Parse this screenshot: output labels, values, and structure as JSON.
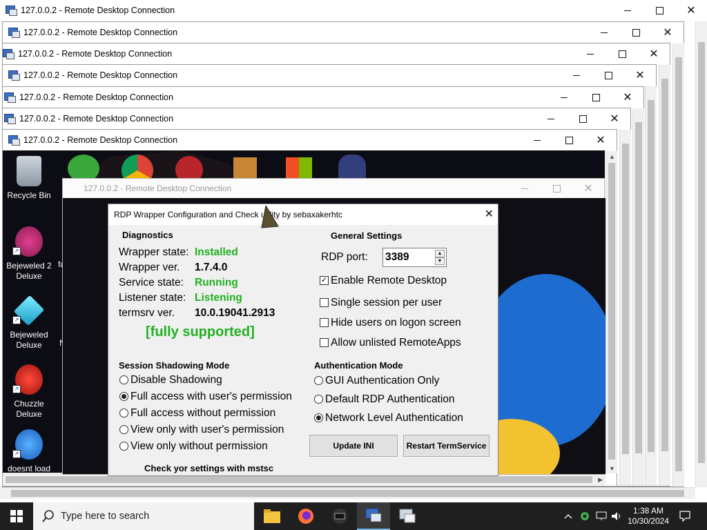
{
  "windows": [
    {
      "title": "127.0.0.2 - Remote Desktop Connection"
    },
    {
      "title": "127.0.0.2 - Remote Desktop Connection"
    },
    {
      "title": "127.0.0.2 - Remote Desktop Connection"
    },
    {
      "title": "127.0.0.2 - Remote Desktop Connection"
    },
    {
      "title": "127.0.0.2 - Remote Desktop Connection"
    },
    {
      "title": "127.0.0.2 - Remote Desktop Connection"
    },
    {
      "title": "127.0.0.2 - Remote Desktop Connection"
    },
    {
      "title": "127.0.0.2 - Remote Desktop Connection"
    }
  ],
  "desktop": {
    "icons": [
      {
        "label": "Recycle Bin"
      },
      {
        "label": "Bejeweled 2 Deluxe"
      },
      {
        "label": "Bejeweled Deluxe"
      },
      {
        "label": "Chuzzle Deluxe"
      },
      {
        "label": "doesnt load"
      }
    ],
    "peek": {
      "fa": "fa",
      "n": "N"
    }
  },
  "dialog": {
    "title": "RDP Wrapper Configuration and Check utility by sebaxakerhtc",
    "diagnostics": {
      "header": "Diagnostics",
      "wrapper_state_label": "Wrapper state:",
      "wrapper_state_value": "Installed",
      "wrapper_ver_label": "Wrapper ver.",
      "wrapper_ver_value": "1.7.4.0",
      "service_state_label": "Service state:",
      "service_state_value": "Running",
      "listener_state_label": "Listener state:",
      "listener_state_value": "Listening",
      "termsrv_label": "termsrv ver.",
      "termsrv_value": "10.0.19041.2913",
      "support_status": "[fully supported]"
    },
    "general": {
      "header": "General Settings",
      "rdp_port_label": "RDP port:",
      "rdp_port_value": "3389",
      "enable_remote_desktop": "Enable Remote Desktop",
      "single_session": "Single session per user",
      "hide_users": "Hide users on logon screen",
      "allow_unlisted": "Allow unlisted RemoteApps"
    },
    "shadowing": {
      "header": "Session Shadowing Mode",
      "options": [
        {
          "label": "Disable Shadowing"
        },
        {
          "label": "Full access with user's permission"
        },
        {
          "label": "Full access without permission"
        },
        {
          "label": "View only with user's permission"
        },
        {
          "label": "View only without permission"
        }
      ],
      "selected": "Full access with user's permission"
    },
    "auth": {
      "header": "Authentication Mode",
      "options": [
        {
          "label": "GUI Authentication Only"
        },
        {
          "label": "Default RDP Authentication"
        },
        {
          "label": "Network Level Authentication"
        }
      ],
      "selected": "Network Level Authentication"
    },
    "buttons": {
      "update_ini": "Update INI",
      "restart": "Restart TermService"
    },
    "footer": "Check yor settings with mstsc"
  },
  "taskbar": {
    "search_placeholder": "Type here to search",
    "time": "1:38 AM",
    "date": "10/30/2024"
  },
  "colors": {
    "installed_green": "#20b020",
    "desktop_bg": "#0c0c14",
    "taskbar_bg": "#1f1f1f"
  }
}
